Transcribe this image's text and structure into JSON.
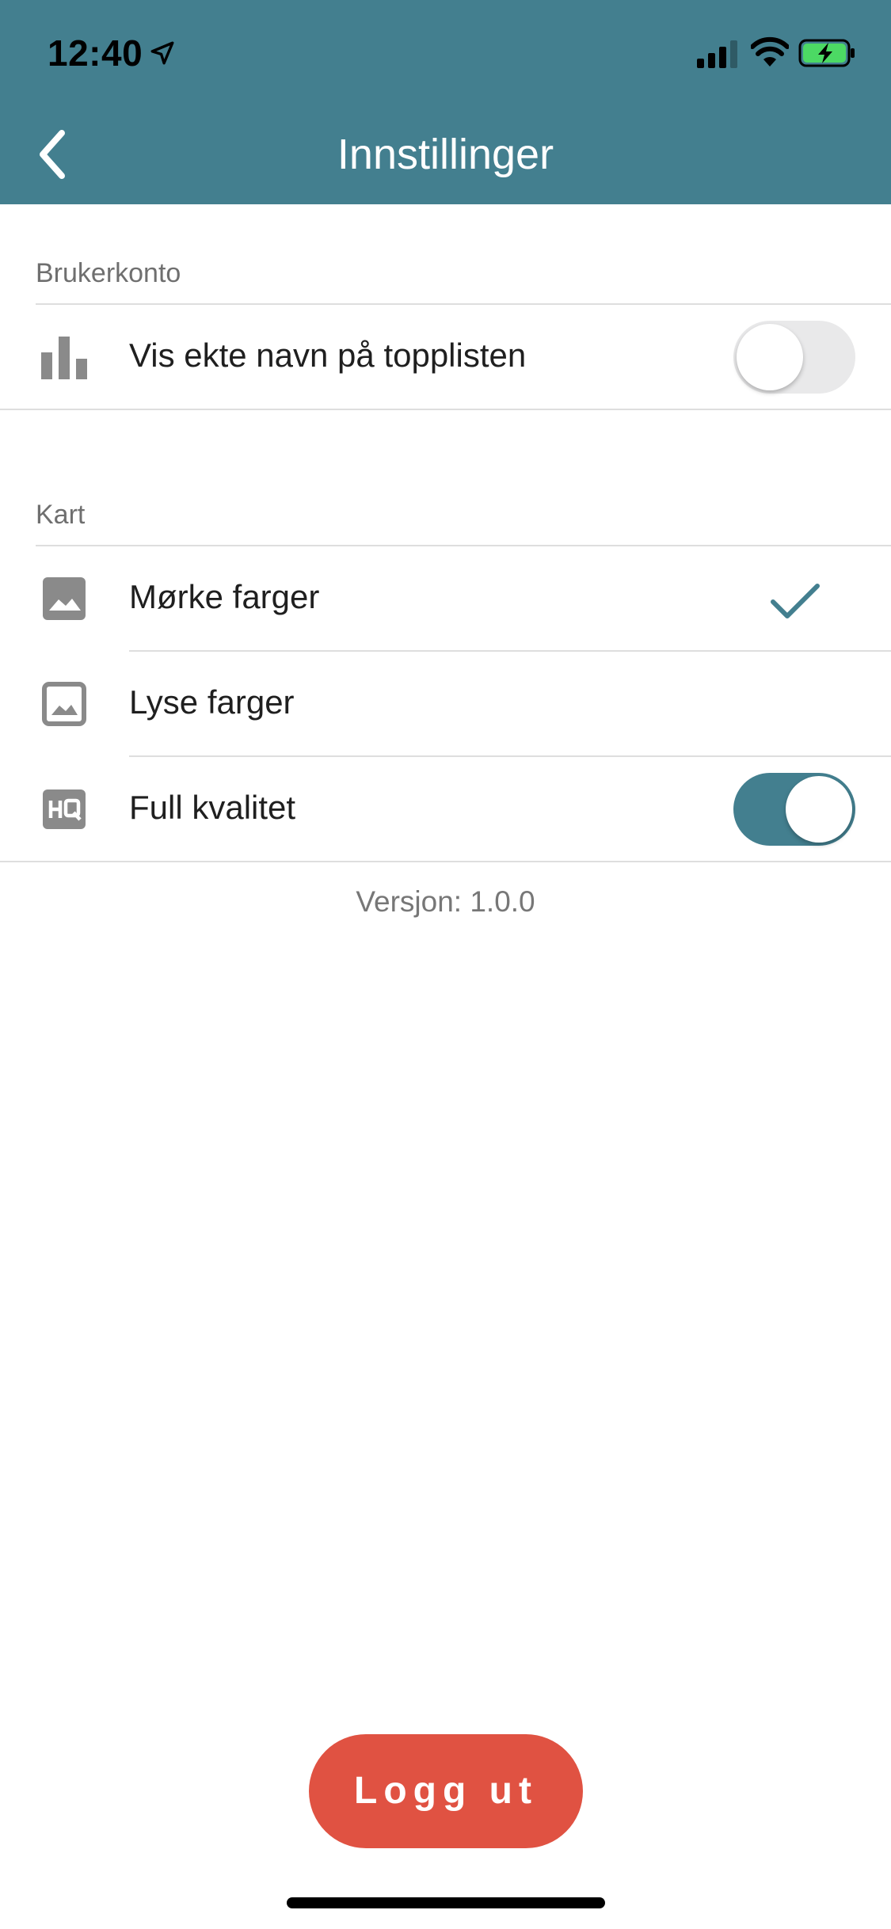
{
  "status_bar": {
    "time": "12:40",
    "icons": [
      "location-arrow-icon",
      "cellular-signal-icon",
      "wifi-icon",
      "battery-charging-icon"
    ]
  },
  "header": {
    "title": "Innstillinger",
    "back_icon": "chevron-left-icon",
    "background_color": "#437f8f"
  },
  "sections": [
    {
      "label": "Brukerkonto",
      "rows": [
        {
          "icon": "bar-chart-icon",
          "label": "Vis ekte navn på topplisten",
          "control": "toggle",
          "on": false
        }
      ]
    },
    {
      "label": "Kart",
      "rows": [
        {
          "icon": "image-filled-icon",
          "label": "Mørke farger",
          "control": "checkmark",
          "selected": true
        },
        {
          "icon": "image-outline-icon",
          "label": "Lyse farger",
          "control": "checkmark",
          "selected": false
        },
        {
          "icon": "hq-icon",
          "label": "Full kvalitet",
          "control": "toggle",
          "on": true
        }
      ]
    }
  ],
  "version": "Versjon: 1.0.0",
  "logout": {
    "label": "Logg ut",
    "color": "#e05242"
  },
  "accent_color": "#437f8f"
}
